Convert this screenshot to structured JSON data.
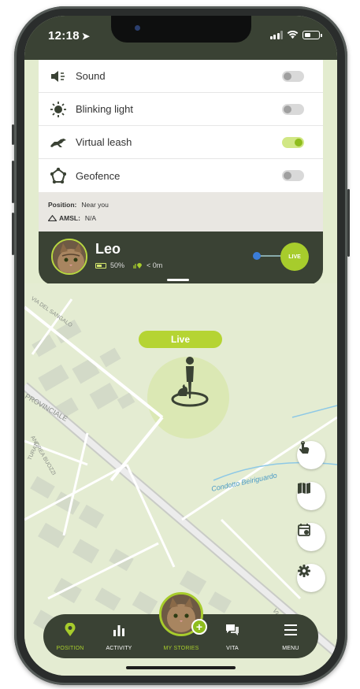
{
  "status": {
    "time": "12:18"
  },
  "settings": [
    {
      "label": "Sound",
      "on": false,
      "icon": "speaker-icon"
    },
    {
      "label": "Blinking light",
      "on": false,
      "icon": "sun-icon"
    },
    {
      "label": "Virtual leash",
      "on": true,
      "icon": "running-dog-icon"
    },
    {
      "label": "Geofence",
      "on": false,
      "icon": "geofence-icon"
    }
  ],
  "info": {
    "position_label": "Position:",
    "position_value": "Near you",
    "amsl_label": "AMSL:",
    "amsl_value": "N/A"
  },
  "pet": {
    "name": "Leo",
    "battery": "50%",
    "distance": "< 0m",
    "live_button": "LIVE"
  },
  "map": {
    "live_label": "Live",
    "streets": [
      "VIA DEL SANGALO",
      "PROVINCIALE",
      "ANDREA BUOZZI",
      "TURATI",
      "Condotto Beiriguardo",
      "VIA PR..."
    ]
  },
  "nav": {
    "items": [
      {
        "label": "POSITION",
        "icon": "location-pin-icon"
      },
      {
        "label": "ACTIVITY",
        "icon": "bar-chart-icon"
      },
      {
        "label": "MY STORIES",
        "icon": "stories-avatar"
      },
      {
        "label": "VITA",
        "icon": "chat-icon"
      },
      {
        "label": "MENU",
        "icon": "hamburger-menu-icon"
      }
    ],
    "plus": "+"
  },
  "colors": {
    "dark_green": "#3a4234",
    "accent_lime": "#a7cc2c",
    "map_bg": "#e4ecd2"
  }
}
